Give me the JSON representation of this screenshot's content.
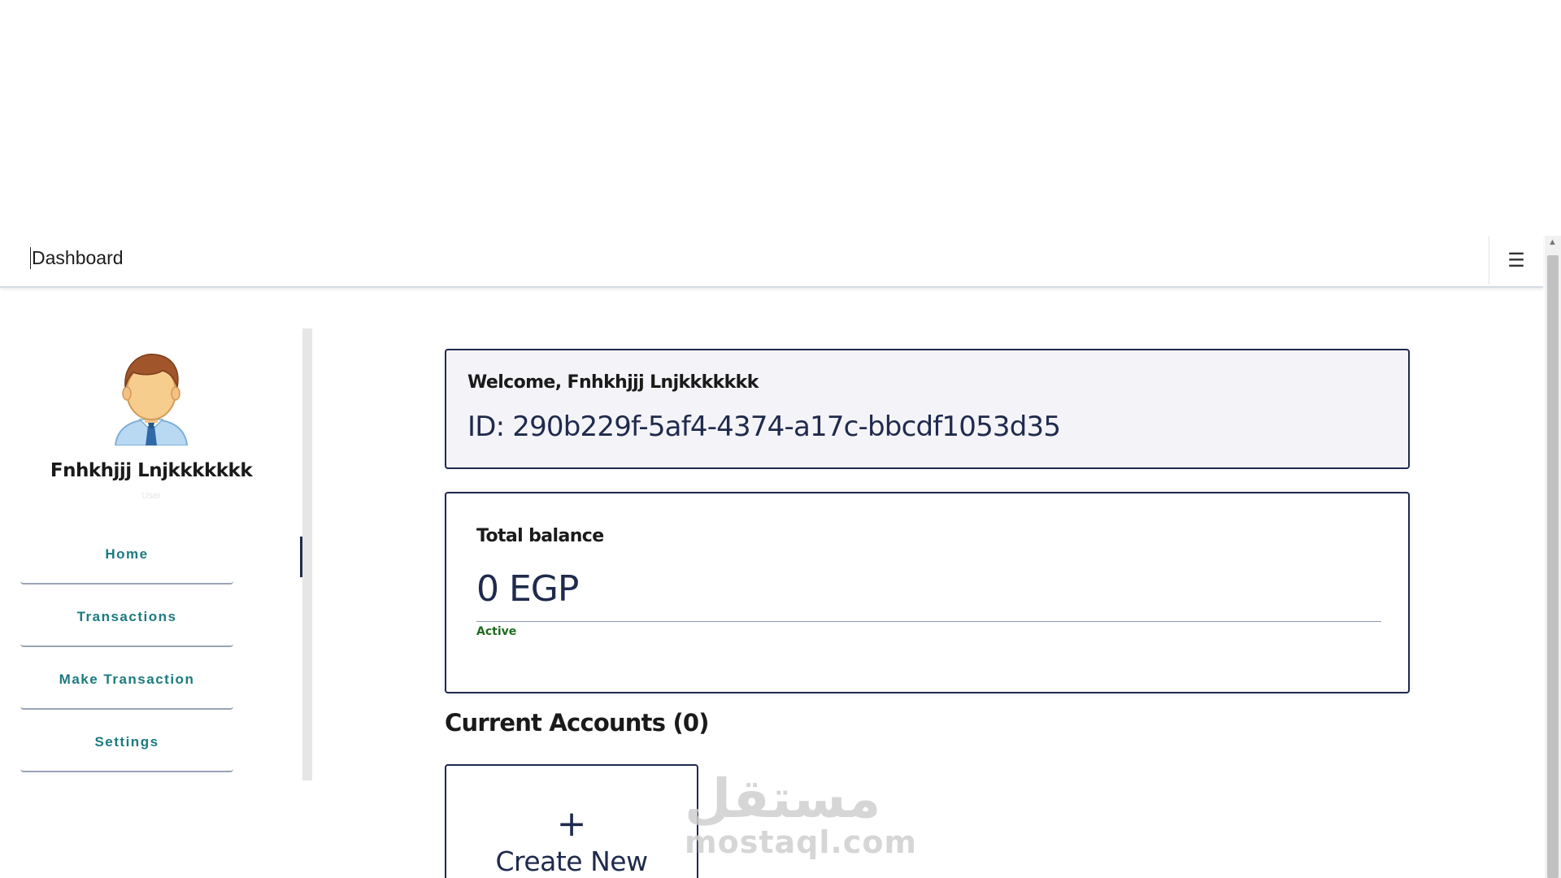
{
  "navbar": {
    "title": "Dashboard",
    "menu_icon": "hamburger-icon",
    "menu_glyph": "☰"
  },
  "sidebar": {
    "avatar_icon": "user-avatar-icon",
    "profile_name": "Fnhkhjjj Lnjkkkkkkk",
    "profile_role": "User",
    "items": [
      {
        "label": "Home"
      },
      {
        "label": "Transactions"
      },
      {
        "label": "Make Transaction"
      },
      {
        "label": "Settings"
      }
    ]
  },
  "welcome": {
    "greeting": "Welcome, Fnhkhjjj Lnjkkkkkkk",
    "id_text": "ID: 290b229f-5af4-4374-a17c-bbcdf1053d35"
  },
  "balance": {
    "label": "Total balance",
    "amount": "0 EGP",
    "status": "Active"
  },
  "accounts": {
    "heading": "Current Accounts (0)",
    "create_plus": "+",
    "create_label": "Create New"
  },
  "watermark": {
    "arabic": "مستقل",
    "latin": "mostaql.com"
  },
  "colors": {
    "primary_navy": "#1f2a4d",
    "nav_teal": "#1b7a80",
    "status_green": "#1f6b1f",
    "card_bg": "#f4f4f8"
  }
}
